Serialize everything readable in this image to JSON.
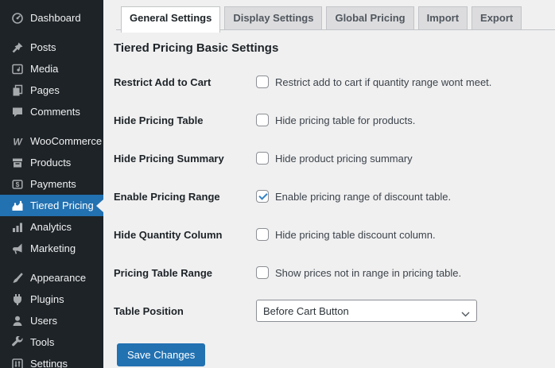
{
  "sidebar": {
    "items": [
      {
        "label": "Dashboard",
        "current": false
      },
      {
        "label": "Posts",
        "current": false
      },
      {
        "label": "Media",
        "current": false
      },
      {
        "label": "Pages",
        "current": false
      },
      {
        "label": "Comments",
        "current": false
      },
      {
        "label": "WooCommerce",
        "current": false
      },
      {
        "label": "Products",
        "current": false
      },
      {
        "label": "Payments",
        "current": false
      },
      {
        "label": "Tiered Pricing",
        "current": true
      },
      {
        "label": "Analytics",
        "current": false
      },
      {
        "label": "Marketing",
        "current": false
      },
      {
        "label": "Appearance",
        "current": false
      },
      {
        "label": "Plugins",
        "current": false
      },
      {
        "label": "Users",
        "current": false
      },
      {
        "label": "Tools",
        "current": false
      },
      {
        "label": "Settings",
        "current": false
      }
    ]
  },
  "tabs": [
    {
      "label": "General Settings",
      "active": true
    },
    {
      "label": "Display Settings",
      "active": false
    },
    {
      "label": "Global Pricing",
      "active": false
    },
    {
      "label": "Import",
      "active": false
    },
    {
      "label": "Export",
      "active": false
    }
  ],
  "main": {
    "heading": "Tiered Pricing Basic Settings",
    "rows": [
      {
        "label": "Restrict Add to Cart",
        "type": "checkbox",
        "checked": false,
        "description": "Restrict add to cart if quantity range wont meet."
      },
      {
        "label": "Hide Pricing Table",
        "type": "checkbox",
        "checked": false,
        "description": "Hide pricing table for products."
      },
      {
        "label": "Hide Pricing Summary",
        "type": "checkbox",
        "checked": false,
        "description": "Hide product pricing summary"
      },
      {
        "label": "Enable Pricing Range",
        "type": "checkbox",
        "checked": true,
        "description": "Enable pricing range of discount table."
      },
      {
        "label": "Hide Quantity Column",
        "type": "checkbox",
        "checked": false,
        "description": "Hide pricing table discount column."
      },
      {
        "label": "Pricing Table Range",
        "type": "checkbox",
        "checked": false,
        "description": "Show prices not in range in pricing table."
      },
      {
        "label": "Table Position",
        "type": "select",
        "value": "Before Cart Button"
      }
    ],
    "save_button": "Save Changes"
  },
  "colors": {
    "sidebar_bg": "#1d2327",
    "accent": "#2271b1",
    "page_bg": "#f0f0f1",
    "active_tab_bg": "#ffffff",
    "inactive_tab_bg": "#dcdcde",
    "tab_border": "#c3c4c7",
    "input_border": "#8c8f94",
    "checkmark": "#3582c4",
    "button_bg": "#2271b1"
  }
}
